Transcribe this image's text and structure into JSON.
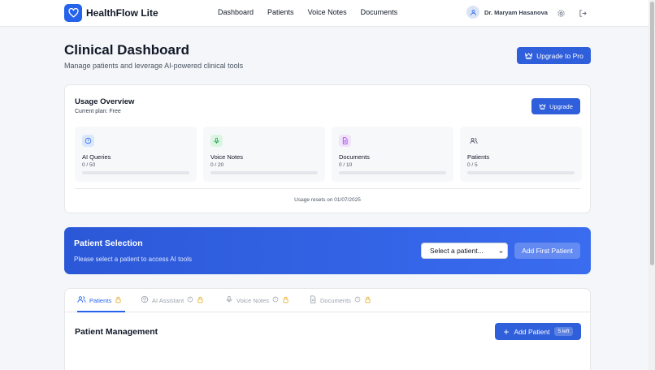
{
  "app": {
    "name": "HealthFlow Lite",
    "nav": [
      "Dashboard",
      "Patients",
      "Voice Notes",
      "Documents"
    ],
    "user_name": "Dr. Maryam Hasanova"
  },
  "page": {
    "title": "Clinical Dashboard",
    "subtitle": "Manage patients and leverage AI-powered clinical tools",
    "upgrade_pro_label": "Upgrade to Pro"
  },
  "usage": {
    "title": "Usage Overview",
    "plan": "Current plan: Free",
    "upgrade_label": "Upgrade",
    "stats": [
      {
        "label": "AI Queries",
        "count": "0 / 50",
        "progress": 0
      },
      {
        "label": "Voice Notes",
        "count": "0 / 20",
        "progress": 0
      },
      {
        "label": "Documents",
        "count": "0 / 10",
        "progress": 0
      },
      {
        "label": "Patients",
        "count": "0 / 5",
        "progress": 0
      }
    ],
    "reset_text": "Usage resets on 01/07/2025"
  },
  "patient_selection": {
    "title": "Patient Selection",
    "subtitle": "Please select a patient to access AI tools",
    "select_placeholder": "Select a patient...",
    "add_first_label": "Add First Patient"
  },
  "tabs": [
    {
      "label": "Patients",
      "active": true
    },
    {
      "label": "AI Assistant",
      "active": false
    },
    {
      "label": "Voice Notes",
      "active": false
    },
    {
      "label": "Documents",
      "active": false
    }
  ],
  "patient_management": {
    "title": "Patient Management",
    "add_label": "Add Patient",
    "badge": "5 left"
  },
  "colors": {
    "primary": "#2f5fdb",
    "lock": "#e6a817",
    "ai_icon_bg": "#dbe7fb",
    "voice_icon_bg": "#dcf5e3",
    "doc_icon_bg": "#f1e3f9"
  }
}
